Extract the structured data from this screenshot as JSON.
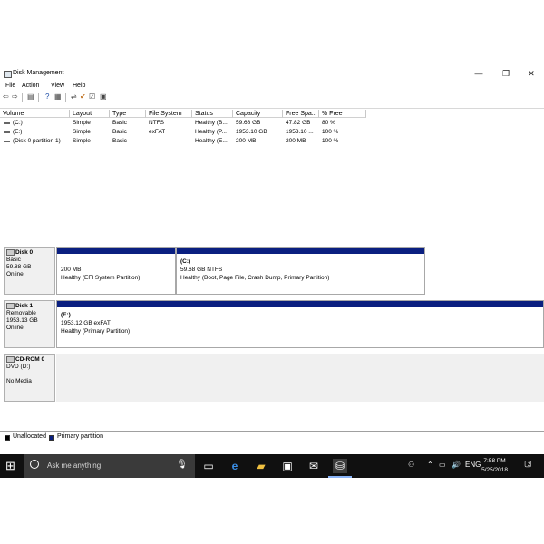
{
  "window": {
    "title": "Disk Management",
    "controls": {
      "minimize": "—",
      "restore": "❐",
      "close": "✕"
    }
  },
  "menu": [
    "File",
    "Action",
    "View",
    "Help"
  ],
  "toolbar": [
    "back-icon",
    "forward-icon",
    "list-view-icon",
    "help-icon",
    "properties-icon",
    "refresh-icon",
    "connect-icon",
    "check-icon",
    "settings-icon"
  ],
  "volume_list": {
    "columns": [
      "Volume",
      "Layout",
      "Type",
      "File System",
      "Status",
      "Capacity",
      "Free Spa...",
      "% Free"
    ],
    "rows": [
      [
        "(C:)",
        "Simple",
        "Basic",
        "NTFS",
        "Healthy (B...",
        "59.68 GB",
        "47.82 GB",
        "80 %"
      ],
      [
        "(E:)",
        "Simple",
        "Basic",
        "exFAT",
        "Healthy (P...",
        "1953.10 GB",
        "1953.10 ...",
        "100 %"
      ],
      [
        "(Disk 0 partition 1)",
        "Simple",
        "Basic",
        "",
        "Healthy (E...",
        "200 MB",
        "200 MB",
        "100 %"
      ]
    ]
  },
  "disks": [
    {
      "name": "Disk 0",
      "type": "Basic",
      "size": "59.88 GB",
      "status": "Online",
      "partitions": [
        {
          "label": "",
          "line1": "200 MB",
          "line2": "Healthy (EFI System Partition)"
        },
        {
          "label": "(C:)",
          "line1": "59.68 GB NTFS",
          "line2": "Healthy (Boot, Page File, Crash Dump, Primary Partition)"
        }
      ]
    },
    {
      "name": "Disk 1",
      "type": "Removable",
      "size": "1953.13 GB",
      "status": "Online",
      "partitions": [
        {
          "label": "(E:)",
          "line1": "1953.12 GB exFAT",
          "line2": "Healthy (Primary Partition)"
        }
      ]
    },
    {
      "name": "CD-ROM 0",
      "type": "DVD (D:)",
      "size": "",
      "status": "No Media",
      "partitions": []
    }
  ],
  "legend": [
    {
      "label": "Unallocated",
      "color": "#000000"
    },
    {
      "label": "Primary partition",
      "color": "#0a1f80"
    }
  ],
  "taskbar": {
    "search_placeholder": "Ask me anything",
    "apps": [
      "task-view-icon",
      "edge-icon",
      "file-explorer-icon",
      "store-icon",
      "mail-icon",
      "disk-management-icon"
    ],
    "tray": {
      "language": "ENG",
      "time": "7:58 PM",
      "date": "5/25/2018",
      "notifications": "2"
    }
  }
}
